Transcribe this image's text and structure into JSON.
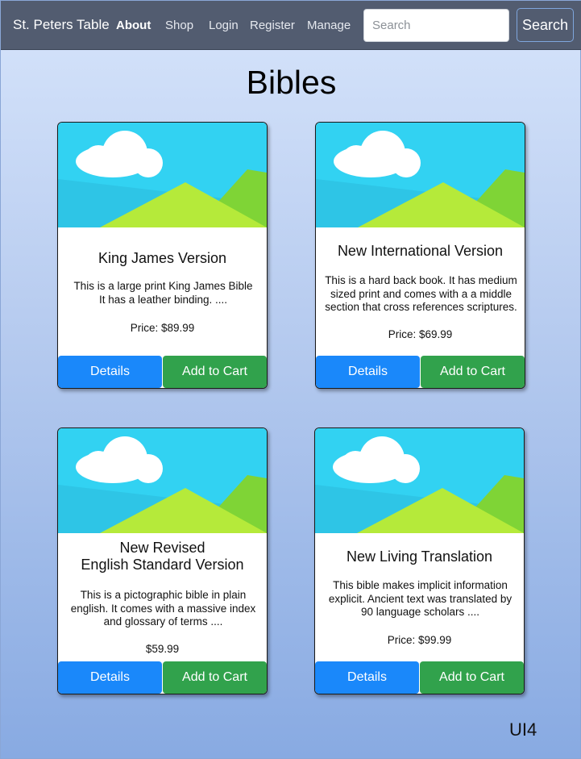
{
  "nav": {
    "brand": "St. Peters Table",
    "links": [
      "About",
      "Shop",
      "Login",
      "Register",
      "Manage"
    ],
    "search_placeholder": "Search",
    "search_button": "Search"
  },
  "page": {
    "title": "Bibles",
    "footer_tag": "UI4"
  },
  "products": [
    {
      "title": "King James Version",
      "description": "This is a large print King James Bible\nIt has a leather binding. ....",
      "price": "Price: $89.99",
      "details_label": "Details",
      "cart_label": "Add to Cart"
    },
    {
      "title": "New International Version",
      "description": "This is a hard back book.  It has medium\nsized print and comes with a a middle\nsection that cross references scriptures.",
      "price": "Price: $69.99",
      "details_label": "Details",
      "cart_label": "Add to Cart"
    },
    {
      "title": "New Revised\nEnglish Standard Version",
      "description": "This is a pictographic bible in plain\nenglish.  It comes with a massive index\nand glossary of terms ....",
      "price": "$59.99",
      "details_label": "Details",
      "cart_label": "Add to Cart"
    },
    {
      "title": "New Living Translation",
      "description": "This bible makes implicit information\nexplicit.  Ancient text was translated by\n90 language scholars ....",
      "price": "Price: $99.99",
      "details_label": "Details",
      "cart_label": "Add to Cart"
    }
  ],
  "colors": {
    "navbar": "#525c70",
    "details_button": "#1a88fa",
    "cart_button": "#31a24c",
    "sky": "#32d2f2",
    "hill_light": "#b5ea3a",
    "hill_dark": "#7fd436"
  }
}
